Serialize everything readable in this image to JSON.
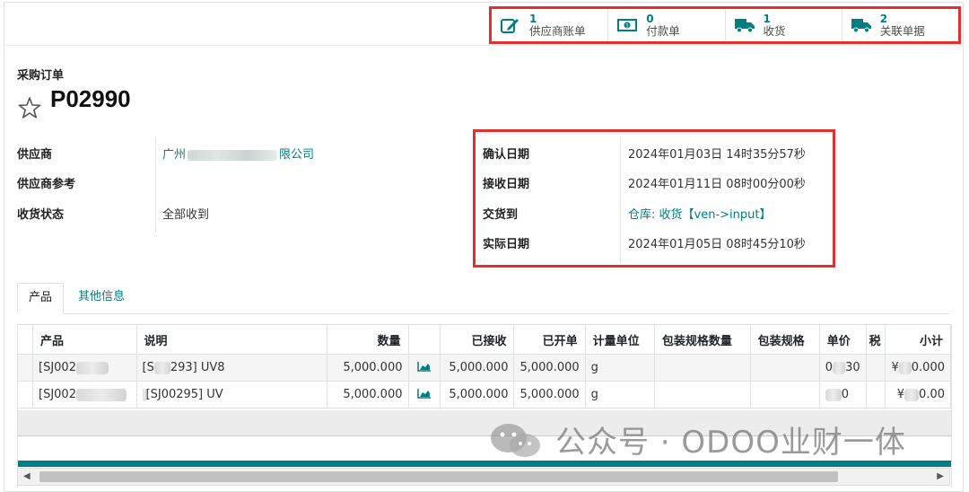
{
  "smart_buttons": [
    {
      "count": "1",
      "label": "供应商账单",
      "icon": "pencil-square-icon"
    },
    {
      "count": "0",
      "label": "付款单",
      "icon": "money-icon"
    },
    {
      "count": "1",
      "label": "收货",
      "icon": "truck-icon"
    },
    {
      "count": "2",
      "label": "关联单据",
      "icon": "truck-icon"
    }
  ],
  "form": {
    "type_label": "采购订单",
    "name": "P02990"
  },
  "left_fields": {
    "partner_label": "供应商",
    "partner_value_prefix": "广州",
    "partner_value_suffix": "限公司",
    "partner_ref_label": "供应商参考",
    "receipt_status_label": "收货状态",
    "receipt_status_value": "全部收到"
  },
  "right_fields": {
    "date_approve_label": "确认日期",
    "date_approve_value": "2024年01月03日 14时35分57秒",
    "date_planned_label": "接收日期",
    "date_planned_value": "2024年01月11日 08时00分00秒",
    "deliver_to_label": "交货到",
    "deliver_to_value": "仓库: 收货【ven->input】",
    "effective_date_label": "实际日期",
    "effective_date_value": "2024年01月05日 08时45分10秒"
  },
  "tabs": {
    "products": "产品",
    "other_info": "其他信息"
  },
  "table": {
    "headers": {
      "product": "产品",
      "description": "说明",
      "qty": "数量",
      "received": "已接收",
      "billed": "已开单",
      "uom": "计量单位",
      "packaging_qty": "包装规格数量",
      "packaging": "包装规格",
      "price_unit": "单价",
      "taxes": "税",
      "subtotal": "小计"
    },
    "rows": [
      {
        "product": "[SJ002",
        "description": "[S",
        "description2": "293] UV8",
        "qty": "5,000.000",
        "received": "5,000.000",
        "billed": "5,000.000",
        "uom": "g",
        "price": "0",
        "price2": "30",
        "subtotal_prefix": "¥",
        "subtotal_suffix": "0.000"
      },
      {
        "product": "[SJ002",
        "description": "[SJ00295] UV",
        "description2": "",
        "qty": "5,000.000",
        "received": "5,000.000",
        "billed": "5,000.000",
        "uom": "g",
        "price": "",
        "price2": "0",
        "subtotal_prefix": "¥",
        "subtotal_suffix": "0.00"
      }
    ]
  },
  "watermark": "公众号 · ODOO业财一体",
  "colors": {
    "accent": "#017e84",
    "highlight_border": "#e52e2e"
  }
}
